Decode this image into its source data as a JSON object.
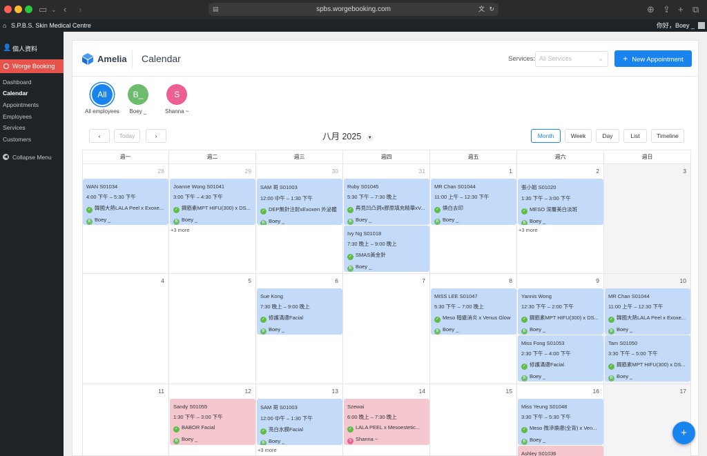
{
  "browser": {
    "url": "spbs.worgebooking.com"
  },
  "adminbar": {
    "site_name": "S.P.B.S. Skin Medical Centre",
    "greeting": "你好，Boey _"
  },
  "sidebar": {
    "profile": "個人資料",
    "plugin": "Worge Booking",
    "items": [
      {
        "label": "Dashboard",
        "active": false
      },
      {
        "label": "Calendar",
        "active": true
      },
      {
        "label": "Appointments",
        "active": false
      },
      {
        "label": "Employees",
        "active": false
      },
      {
        "label": "Services",
        "active": false
      },
      {
        "label": "Customers",
        "active": false
      }
    ],
    "collapse": "Collapse Menu"
  },
  "header": {
    "logo": "Amelia",
    "title": "Calendar",
    "services_label": "Services:",
    "services_placeholder": "All Services",
    "new_appointment": "New Appointment"
  },
  "employees": [
    {
      "initial": "All",
      "name": "All employees",
      "color": "#1a84ee"
    },
    {
      "initial": "B_",
      "name": "Boey _",
      "color": "#6dbb6d"
    },
    {
      "initial": "S",
      "name": "Shanna ~",
      "color": "#ec5f93"
    }
  ],
  "toolbar": {
    "prev": "‹",
    "today": "Today",
    "next": "›",
    "month": "八月 2025",
    "views": [
      "Month",
      "Week",
      "Day",
      "List",
      "Timeline"
    ],
    "active_view": "Month"
  },
  "weekdays": [
    "週一",
    "週二",
    "週三",
    "週四",
    "週五",
    "週六",
    "週日"
  ],
  "weeks": [
    [
      "28",
      "29",
      "30",
      "31",
      "1",
      "2",
      "3"
    ],
    [
      "4",
      "5",
      "6",
      "7",
      "8",
      "9",
      "10"
    ],
    [
      "11",
      "12",
      "13",
      "14",
      "15",
      "16",
      "17"
    ]
  ],
  "events": [
    {
      "week": 0,
      "day": 0,
      "slot": 0,
      "color": "blue",
      "title": "WAN S01034",
      "time": "4:00 下午 – 5:30 下午",
      "service": "韓國大熱LALA Peel x Exoxe...",
      "employee": "Boey _",
      "emp_initial": "B",
      "emp_color": "#6dbb6d"
    },
    {
      "week": 0,
      "day": 1,
      "slot": 0,
      "color": "blue",
      "title": "Joanne Wong S01041",
      "time": "3:00 下午 – 4:30 下午",
      "service": "鋼筋素MPT HIFU(300) x DS...",
      "employee": "Boey _",
      "emp_initial": "B",
      "emp_color": "#6dbb6d"
    },
    {
      "week": 0,
      "day": 2,
      "slot": 0,
      "color": "blue",
      "title": "SAM 哥 S01003",
      "time": "12:00 中午 – 1:30 下午",
      "service": "DEP無針注射xExoxen 外泌體",
      "employee": "Boey _",
      "emp_initial": "B",
      "emp_color": "#6dbb6d"
    },
    {
      "week": 0,
      "day": 3,
      "slot": 0,
      "color": "blue",
      "title": "Ruby S01045",
      "time": "5:30 下午 – 7:30 晚上",
      "service": "再見凹凸洞x膠原填充精華xV...",
      "employee": "Boey _",
      "emp_initial": "B",
      "emp_color": "#6dbb6d"
    },
    {
      "week": 0,
      "day": 3,
      "slot": 1,
      "color": "blue",
      "title": "Ivy Ng S01018",
      "time": "7:30 晚上 – 9:00 晚上",
      "service": "SMAS黃金針",
      "employee": "Boey _",
      "emp_initial": "B",
      "emp_color": "#6dbb6d"
    },
    {
      "week": 0,
      "day": 4,
      "slot": 0,
      "color": "blue",
      "title": "MR Chan S01044",
      "time": "11:00 上午 – 12:30 下午",
      "service": "煥白去印",
      "employee": "Boey _",
      "emp_initial": "B",
      "emp_color": "#6dbb6d"
    },
    {
      "week": 0,
      "day": 5,
      "slot": 0,
      "color": "blue",
      "title": "張小姐 S01020",
      "time": "1:30 下午 – 3:00 下午",
      "service": "MESO 深層美白淡斑",
      "employee": "Boey _",
      "emp_initial": "B",
      "emp_color": "#6dbb6d"
    },
    {
      "week": 1,
      "day": 2,
      "slot": 0,
      "color": "blue",
      "title": "Sue Kong",
      "time": "7:30 晚上 – 9:00 晚上",
      "service": "修護滿膚Facial",
      "employee": "Boey _",
      "emp_initial": "B",
      "emp_color": "#6dbb6d"
    },
    {
      "week": 1,
      "day": 4,
      "slot": 0,
      "color": "blue",
      "title": "MISS LEE S01047",
      "time": "5:30 下午 – 7:00 晚上",
      "service": "Meso 暗瘡消炎 x Venus Glow",
      "employee": "Boey _",
      "emp_initial": "B",
      "emp_color": "#6dbb6d"
    },
    {
      "week": 1,
      "day": 5,
      "slot": 0,
      "color": "blue",
      "title": "Yannis Wong",
      "time": "12:30 下午 – 2:00 下午",
      "service": "鋼筋素MPT HIFU(300) x DS...",
      "employee": "Boey _",
      "emp_initial": "B",
      "emp_color": "#6dbb6d"
    },
    {
      "week": 1,
      "day": 5,
      "slot": 1,
      "color": "blue",
      "title": "Miss Fong S01053",
      "time": "2:30 下午 – 4:00 下午",
      "service": "修護滿膚Facial",
      "employee": "Boey _",
      "emp_initial": "B",
      "emp_color": "#6dbb6d"
    },
    {
      "week": 1,
      "day": 6,
      "slot": 0,
      "color": "blue",
      "title": "MR Chan S01044",
      "time": "11:00 上午 – 12:30 下午",
      "service": "韓國大熱LALA Peel x Exoxe...",
      "employee": "Boey _",
      "emp_initial": "B",
      "emp_color": "#6dbb6d"
    },
    {
      "week": 1,
      "day": 6,
      "slot": 1,
      "color": "blue",
      "title": "Tam S01050",
      "time": "3:30 下午 – 5:00 下午",
      "service": "鋼筋素MPT HIFU(300) x DS...",
      "employee": "Boey _",
      "emp_initial": "B",
      "emp_color": "#6dbb6d"
    },
    {
      "week": 2,
      "day": 1,
      "slot": 0,
      "color": "pink",
      "title": "Sandy S01055",
      "time": "1:30 下午 – 3:00 下午",
      "service": "BABOR Facial",
      "employee": "Boey _",
      "emp_initial": "B",
      "emp_color": "#6dbb6d"
    },
    {
      "week": 2,
      "day": 2,
      "slot": 0,
      "color": "blue",
      "title": "SAM 哥 S01003",
      "time": "12:00 中午 – 1:30 下午",
      "service": "亮白水膜Facial",
      "employee": "Boey _",
      "emp_initial": "B",
      "emp_color": "#6dbb6d"
    },
    {
      "week": 2,
      "day": 3,
      "slot": 0,
      "color": "pink",
      "title": "Szewai",
      "time": "6:00 晚上 – 7:30 晚上",
      "service": "LALA PEEL x Mesoestetic...",
      "employee": "Shanna ~",
      "emp_initial": "S",
      "emp_color": "#ec5f93"
    },
    {
      "week": 2,
      "day": 5,
      "slot": 0,
      "color": "blue",
      "title": "Miss Yeung S01048",
      "time": "3:30 下午 – 5:30 下午",
      "service": "Meso 微滲煥膚(全背) x Ven...",
      "employee": "Boey _",
      "emp_initial": "B",
      "emp_color": "#6dbb6d"
    },
    {
      "week": 2,
      "day": 5,
      "slot": 1,
      "color": "pink",
      "title": "Ashley S01036",
      "time": "",
      "service": "",
      "employee": "",
      "emp_initial": "",
      "emp_color": "#6dbb6d"
    }
  ],
  "more_links": [
    {
      "week": 0,
      "day": 1,
      "label": "+3 more"
    },
    {
      "week": 0,
      "day": 5,
      "label": "+3 more"
    },
    {
      "week": 2,
      "day": 2,
      "label": "+3 more"
    }
  ],
  "fab": "+",
  "colors": {
    "accent": "#1a84ee",
    "event_blue": "#c3dbf9",
    "event_pink": "#f5c8d0",
    "menu_active": "#e5534b"
  }
}
